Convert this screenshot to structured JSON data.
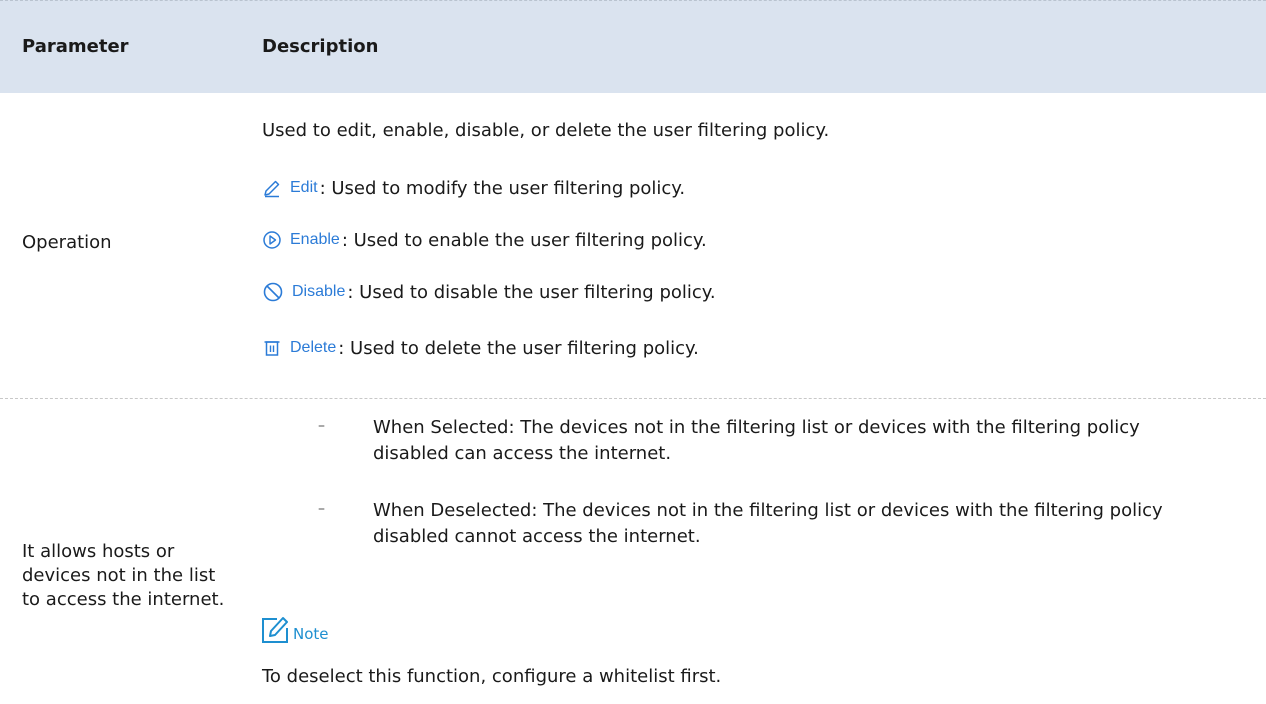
{
  "table": {
    "headers": {
      "parameter": "Parameter",
      "description": "Description"
    },
    "rows": [
      {
        "parameter": "Operation",
        "intro": "Used to edit, enable, disable, or delete the user filtering policy.",
        "operations": [
          {
            "button": "Edit",
            "icon": "pencil-icon",
            "text": ": Used to modify the user filtering policy."
          },
          {
            "button": "Enable",
            "icon": "play-circle-icon",
            "text": ": Used to enable the user filtering policy."
          },
          {
            "button": "Disable",
            "icon": "prohibited-icon",
            "text": ": Used to disable the user filtering policy."
          },
          {
            "button": "Delete",
            "icon": "trash-icon",
            "text": ": Used to delete the user filtering policy."
          }
        ]
      },
      {
        "parameter": "It allows hosts or devices not in the list to access the internet.",
        "bullets": [
          {
            "marker": "–",
            "text": "When Selected: The devices not in the filtering list or devices with the filtering policy disabled can access the internet."
          },
          {
            "marker": "–",
            "text": "When Deselected: The devices not in the filtering list or devices with the filtering policy disabled cannot access the internet."
          }
        ],
        "note": {
          "label": "Note",
          "icon": "note-edit-icon",
          "text": "To deselect this function, configure a whitelist first."
        }
      }
    ]
  },
  "colors": {
    "header_bg": "#dae3ef",
    "button_blue": "#2b7bd7",
    "note_blue": "#1e8fd0"
  }
}
